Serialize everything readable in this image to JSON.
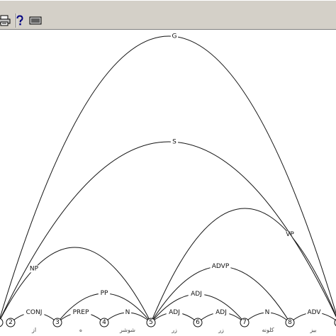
{
  "toolbar": {
    "buttons": [
      {
        "icon": "print-icon"
      },
      {
        "icon": "help-icon"
      },
      {
        "icon": "keyboard-icon"
      }
    ]
  },
  "tree": {
    "nodes": [
      {
        "id": "1",
        "label": ""
      },
      {
        "id": "2",
        "label": "2"
      },
      {
        "id": "3",
        "label": "3"
      },
      {
        "id": "4",
        "label": "4"
      },
      {
        "id": "5",
        "label": "5"
      },
      {
        "id": "6",
        "label": "6"
      },
      {
        "id": "7",
        "label": "7"
      },
      {
        "id": "8",
        "label": "8"
      },
      {
        "id": "9",
        "label": ""
      }
    ],
    "words": [
      {
        "after": "2",
        "text": "از"
      },
      {
        "after": "3",
        "text": "ه"
      },
      {
        "after": "4",
        "text": "شوشر"
      },
      {
        "after": "5",
        "text": "زر"
      },
      {
        "after": "6",
        "text": "زر"
      },
      {
        "after": "7",
        "text": "کلونه"
      },
      {
        "after": "8",
        "text": "بیز"
      }
    ],
    "edges": [
      {
        "from": "2",
        "to": "3",
        "label": "CONJ"
      },
      {
        "from": "3",
        "to": "4",
        "label": "PREP"
      },
      {
        "from": "4",
        "to": "5",
        "label": "N"
      },
      {
        "from": "3",
        "to": "5",
        "label": "PP"
      },
      {
        "from": "1",
        "to": "5",
        "label": "NP"
      },
      {
        "from": "5",
        "to": "6",
        "label": "ADJ"
      },
      {
        "from": "6",
        "to": "7",
        "label": "ADJ"
      },
      {
        "from": "5",
        "to": "7",
        "label": "ADJ"
      },
      {
        "from": "7",
        "to": "8",
        "label": "N"
      },
      {
        "from": "5",
        "to": "8",
        "label": "ADVP"
      },
      {
        "from": "8",
        "to": "9",
        "label": "ADV"
      },
      {
        "from": "5",
        "to": "9",
        "label": "VP"
      },
      {
        "from": "1",
        "to": "9",
        "label": "S"
      },
      {
        "from": "1",
        "to": "9",
        "label": "G"
      }
    ]
  }
}
